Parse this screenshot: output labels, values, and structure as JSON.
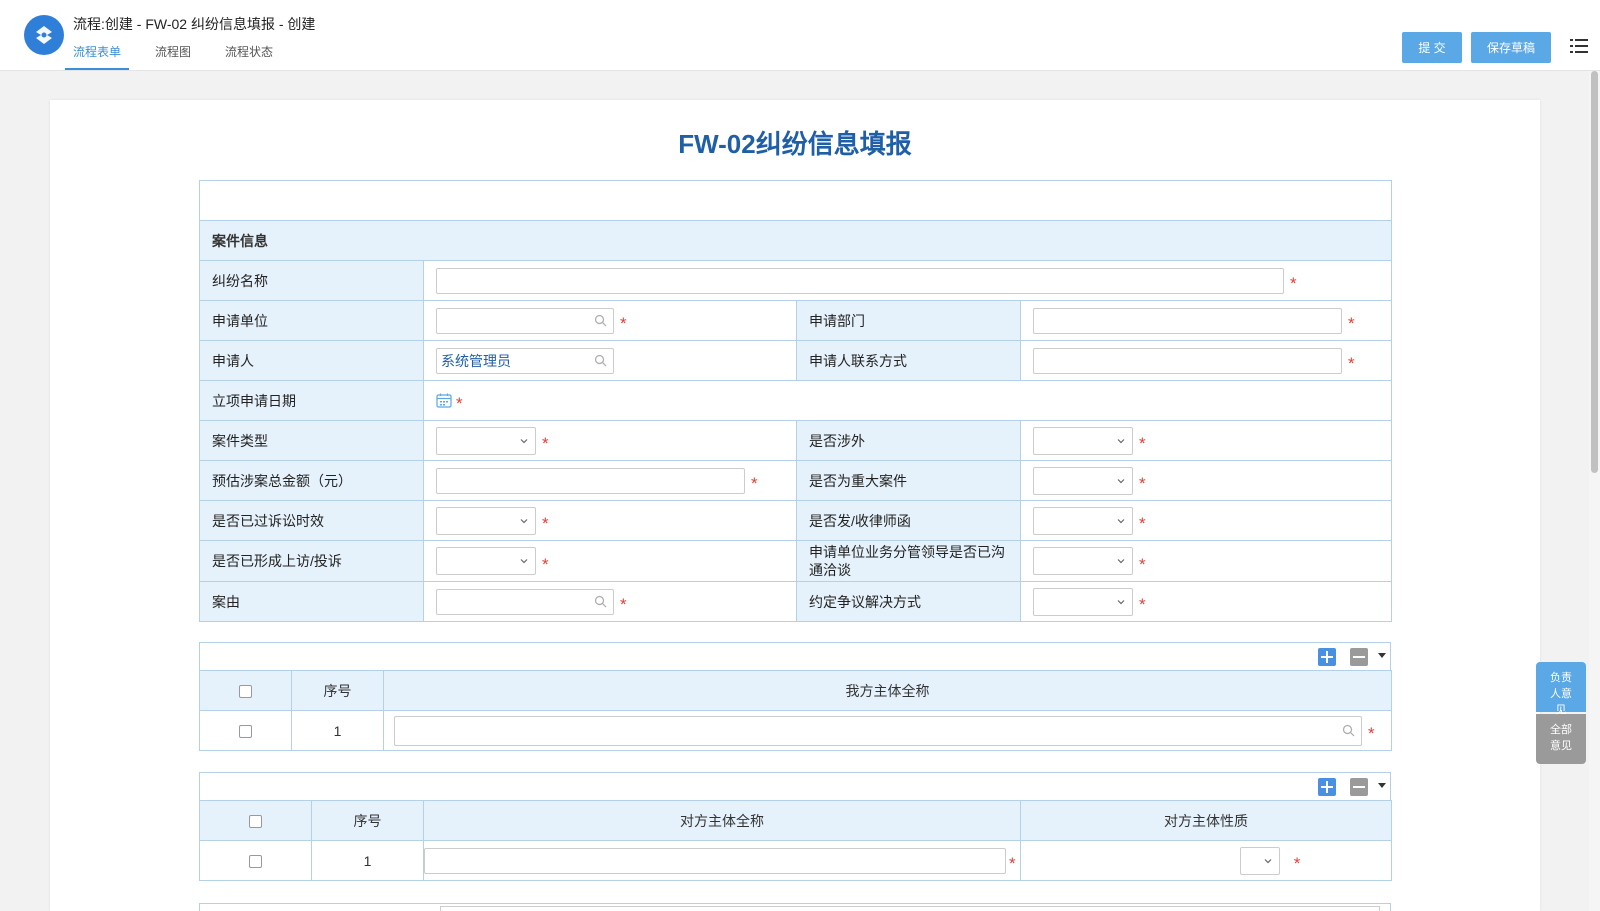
{
  "header": {
    "title": "流程:创建 - FW-02 纠纷信息填报 - 创建",
    "tabs": [
      {
        "label": "流程表单",
        "active": true
      },
      {
        "label": "流程图",
        "active": false
      },
      {
        "label": "流程状态",
        "active": false
      }
    ],
    "submit_label": "提 交",
    "save_draft_label": "保存草稿",
    "menu_icon": "list-icon",
    "accent_color": "#5aa8e6"
  },
  "form": {
    "title": "FW-02纠纷信息填报",
    "section_case": "案件信息",
    "fields": {
      "dispute_name": "纠纷名称",
      "apply_unit": "申请单位",
      "apply_dept": "申请部门",
      "applicant": "申请人",
      "applicant_value": "系统管理员",
      "applicant_contact": "申请人联系方式",
      "apply_date": "立项申请日期",
      "case_type": "案件类型",
      "is_foreign": "是否涉外",
      "est_amount": "预估涉案总金额（元）",
      "is_major": "是否为重大案件",
      "past_limitation": "是否已过诉讼时效",
      "lawyer_letter": "是否发/收律师函",
      "petition": "是否已形成上访/投诉",
      "leader_talk": "申请单位业务分管领导是否已沟通洽谈",
      "cause": "案由",
      "dispute_resolution": "约定争议解决方式"
    },
    "required_mark": "*"
  },
  "our_party_table": {
    "columns": [
      "序号",
      "我方主体全称"
    ],
    "rows": [
      {
        "index": "1"
      }
    ]
  },
  "counter_party_table": {
    "columns": [
      "序号",
      "对方主体全称",
      "对方主体性质"
    ],
    "rows": [
      {
        "index": "1"
      }
    ]
  },
  "float_panel": {
    "owner_opinion": "负责人意见",
    "all_opinion": "全部意见"
  }
}
